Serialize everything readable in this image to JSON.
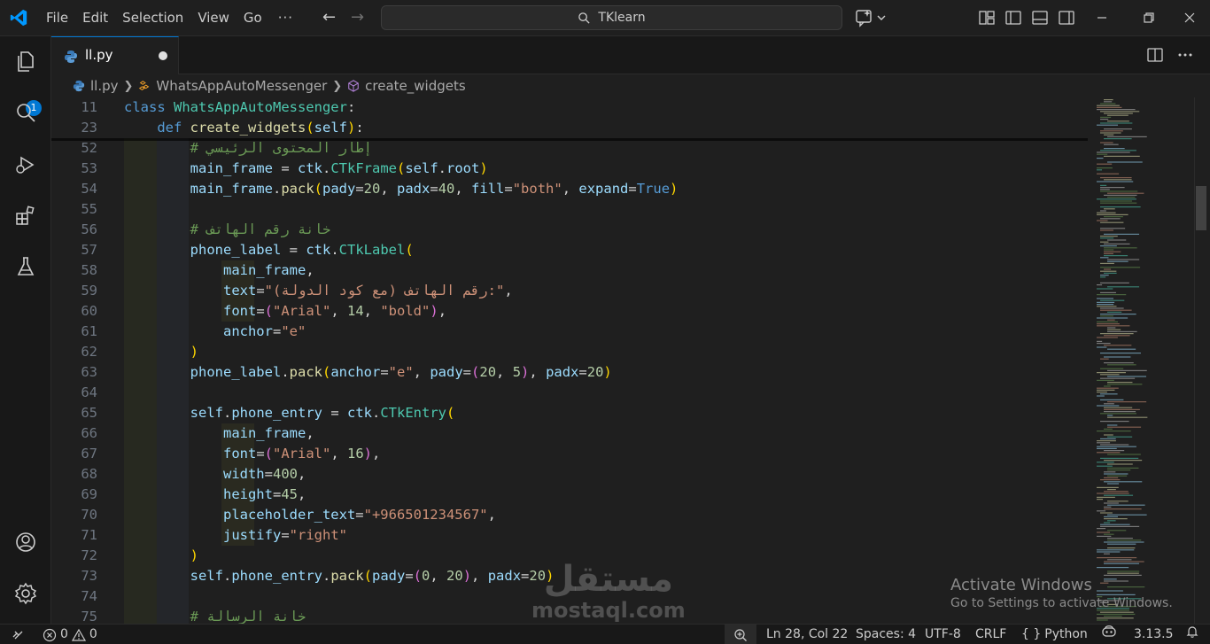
{
  "menu": {
    "items": [
      "File",
      "Edit",
      "Selection",
      "View",
      "Go"
    ],
    "more": "···"
  },
  "search": {
    "text": "TKlearn"
  },
  "activity": {
    "explorer_badge": "1"
  },
  "tab": {
    "label": "ll.py"
  },
  "breadcrumb": {
    "file": "ll.py",
    "class": "WhatsAppAutoMessenger",
    "method": "create_widgets"
  },
  "editor": {
    "sticky_lines": [
      {
        "ln": "11",
        "tokens": [
          [
            "kw",
            "class "
          ],
          [
            "cls",
            "WhatsAppAutoMessenger"
          ],
          [
            "plain",
            ":"
          ]
        ]
      },
      {
        "ln": "23",
        "tokens": [
          [
            "plain",
            "    "
          ],
          [
            "kw",
            "def "
          ],
          [
            "fn",
            "create_widgets"
          ],
          [
            "p1",
            "("
          ],
          [
            "var",
            "self"
          ],
          [
            "p1",
            ")"
          ],
          [
            "plain",
            ":"
          ]
        ]
      }
    ],
    "lines": [
      {
        "ln": "52",
        "tokens": [
          [
            "plain",
            "        "
          ],
          [
            "com",
            "# إطار المحتوى الرئيسي"
          ]
        ]
      },
      {
        "ln": "53",
        "tokens": [
          [
            "plain",
            "        "
          ],
          [
            "var",
            "main_frame"
          ],
          [
            "plain",
            " = "
          ],
          [
            "var",
            "ctk"
          ],
          [
            "plain",
            "."
          ],
          [
            "cls",
            "CTkFrame"
          ],
          [
            "p1",
            "("
          ],
          [
            "var",
            "self"
          ],
          [
            "plain",
            "."
          ],
          [
            "var",
            "root"
          ],
          [
            "p1",
            ")"
          ]
        ]
      },
      {
        "ln": "54",
        "tokens": [
          [
            "plain",
            "        "
          ],
          [
            "var",
            "main_frame"
          ],
          [
            "plain",
            "."
          ],
          [
            "fn",
            "pack"
          ],
          [
            "p1",
            "("
          ],
          [
            "var",
            "pady"
          ],
          [
            "plain",
            "="
          ],
          [
            "num",
            "20"
          ],
          [
            "plain",
            ", "
          ],
          [
            "var",
            "padx"
          ],
          [
            "plain",
            "="
          ],
          [
            "num",
            "40"
          ],
          [
            "plain",
            ", "
          ],
          [
            "var",
            "fill"
          ],
          [
            "plain",
            "="
          ],
          [
            "str",
            "\"both\""
          ],
          [
            "plain",
            ", "
          ],
          [
            "var",
            "expand"
          ],
          [
            "plain",
            "="
          ],
          [
            "kw",
            "True"
          ],
          [
            "p1",
            ")"
          ]
        ]
      },
      {
        "ln": "55",
        "tokens": []
      },
      {
        "ln": "56",
        "tokens": [
          [
            "plain",
            "        "
          ],
          [
            "com",
            "# خانة رقم الهاتف"
          ]
        ]
      },
      {
        "ln": "57",
        "tokens": [
          [
            "plain",
            "        "
          ],
          [
            "var",
            "phone_label"
          ],
          [
            "plain",
            " = "
          ],
          [
            "var",
            "ctk"
          ],
          [
            "plain",
            "."
          ],
          [
            "cls",
            "CTkLabel"
          ],
          [
            "p1",
            "("
          ]
        ]
      },
      {
        "ln": "58",
        "tokens": [
          [
            "plain",
            "            "
          ],
          [
            "var",
            "main_frame"
          ],
          [
            "plain",
            ","
          ]
        ]
      },
      {
        "ln": "59",
        "tokens": [
          [
            "plain",
            "            "
          ],
          [
            "var",
            "text"
          ],
          [
            "plain",
            "="
          ],
          [
            "str",
            "\"رقم الهاتف (مع كود الدولة):\""
          ],
          [
            "plain",
            ","
          ]
        ]
      },
      {
        "ln": "60",
        "tokens": [
          [
            "plain",
            "            "
          ],
          [
            "var",
            "font"
          ],
          [
            "plain",
            "="
          ],
          [
            "p2",
            "("
          ],
          [
            "str",
            "\"Arial\""
          ],
          [
            "plain",
            ", "
          ],
          [
            "num",
            "14"
          ],
          [
            "plain",
            ", "
          ],
          [
            "str",
            "\"bold\""
          ],
          [
            "p2",
            ")"
          ],
          [
            "plain",
            ","
          ]
        ]
      },
      {
        "ln": "61",
        "tokens": [
          [
            "plain",
            "            "
          ],
          [
            "var",
            "anchor"
          ],
          [
            "plain",
            "="
          ],
          [
            "str",
            "\"e\""
          ]
        ]
      },
      {
        "ln": "62",
        "tokens": [
          [
            "plain",
            "        "
          ],
          [
            "p1",
            ")"
          ]
        ]
      },
      {
        "ln": "63",
        "tokens": [
          [
            "plain",
            "        "
          ],
          [
            "var",
            "phone_label"
          ],
          [
            "plain",
            "."
          ],
          [
            "fn",
            "pack"
          ],
          [
            "p1",
            "("
          ],
          [
            "var",
            "anchor"
          ],
          [
            "plain",
            "="
          ],
          [
            "str",
            "\"e\""
          ],
          [
            "plain",
            ", "
          ],
          [
            "var",
            "pady"
          ],
          [
            "plain",
            "="
          ],
          [
            "p2",
            "("
          ],
          [
            "num",
            "20"
          ],
          [
            "plain",
            ", "
          ],
          [
            "num",
            "5"
          ],
          [
            "p2",
            ")"
          ],
          [
            "plain",
            ", "
          ],
          [
            "var",
            "padx"
          ],
          [
            "plain",
            "="
          ],
          [
            "num",
            "20"
          ],
          [
            "p1",
            ")"
          ]
        ]
      },
      {
        "ln": "64",
        "tokens": []
      },
      {
        "ln": "65",
        "tokens": [
          [
            "plain",
            "        "
          ],
          [
            "var",
            "self"
          ],
          [
            "plain",
            "."
          ],
          [
            "var",
            "phone_entry"
          ],
          [
            "plain",
            " = "
          ],
          [
            "var",
            "ctk"
          ],
          [
            "plain",
            "."
          ],
          [
            "cls",
            "CTkEntry"
          ],
          [
            "p1",
            "("
          ]
        ]
      },
      {
        "ln": "66",
        "tokens": [
          [
            "plain",
            "            "
          ],
          [
            "var",
            "main_frame"
          ],
          [
            "plain",
            ","
          ]
        ]
      },
      {
        "ln": "67",
        "tokens": [
          [
            "plain",
            "            "
          ],
          [
            "var",
            "font"
          ],
          [
            "plain",
            "="
          ],
          [
            "p2",
            "("
          ],
          [
            "str",
            "\"Arial\""
          ],
          [
            "plain",
            ", "
          ],
          [
            "num",
            "16"
          ],
          [
            "p2",
            ")"
          ],
          [
            "plain",
            ","
          ]
        ]
      },
      {
        "ln": "68",
        "tokens": [
          [
            "plain",
            "            "
          ],
          [
            "var",
            "width"
          ],
          [
            "plain",
            "="
          ],
          [
            "num",
            "400"
          ],
          [
            "plain",
            ","
          ]
        ]
      },
      {
        "ln": "69",
        "tokens": [
          [
            "plain",
            "            "
          ],
          [
            "var",
            "height"
          ],
          [
            "plain",
            "="
          ],
          [
            "num",
            "45"
          ],
          [
            "plain",
            ","
          ]
        ]
      },
      {
        "ln": "70",
        "tokens": [
          [
            "plain",
            "            "
          ],
          [
            "var",
            "placeholder_text"
          ],
          [
            "plain",
            "="
          ],
          [
            "str",
            "\"+966501234567\""
          ],
          [
            "plain",
            ","
          ]
        ]
      },
      {
        "ln": "71",
        "tokens": [
          [
            "plain",
            "            "
          ],
          [
            "var",
            "justify"
          ],
          [
            "plain",
            "="
          ],
          [
            "str",
            "\"right\""
          ]
        ]
      },
      {
        "ln": "72",
        "tokens": [
          [
            "plain",
            "        "
          ],
          [
            "p1",
            ")"
          ]
        ]
      },
      {
        "ln": "73",
        "tokens": [
          [
            "plain",
            "        "
          ],
          [
            "var",
            "self"
          ],
          [
            "plain",
            "."
          ],
          [
            "var",
            "phone_entry"
          ],
          [
            "plain",
            "."
          ],
          [
            "fn",
            "pack"
          ],
          [
            "p1",
            "("
          ],
          [
            "var",
            "pady"
          ],
          [
            "plain",
            "="
          ],
          [
            "p2",
            "("
          ],
          [
            "num",
            "0"
          ],
          [
            "plain",
            ", "
          ],
          [
            "num",
            "20"
          ],
          [
            "p2",
            ")"
          ],
          [
            "plain",
            ", "
          ],
          [
            "var",
            "padx"
          ],
          [
            "plain",
            "="
          ],
          [
            "num",
            "20"
          ],
          [
            "p1",
            ")"
          ]
        ]
      },
      {
        "ln": "74",
        "tokens": []
      },
      {
        "ln": "75",
        "tokens": [
          [
            "plain",
            "        "
          ],
          [
            "com",
            "# خانة الرسالة"
          ]
        ]
      }
    ]
  },
  "watermark": {
    "activate_title": "Activate Windows",
    "activate_sub": "Go to Settings to activate Windows.",
    "mostaql_ar": "مستقل",
    "mostaql_en": "mostaql.com"
  },
  "status": {
    "errors": "0",
    "warnings": "0",
    "position": "Ln 28, Col 22",
    "spaces": "Spaces: 4",
    "encoding": "UTF-8",
    "eol": "CRLF",
    "language_braces": "{ }",
    "language": "Python",
    "version": "3.13.5"
  },
  "colors": {
    "accent": "#0078d4",
    "background": "#1f1f1f",
    "keyword": "#569cd6",
    "class": "#4ec9b0",
    "function": "#dcdcaa",
    "variable": "#9cdcfe",
    "string": "#ce9178",
    "number": "#b5cea8",
    "comment": "#6a9955"
  }
}
